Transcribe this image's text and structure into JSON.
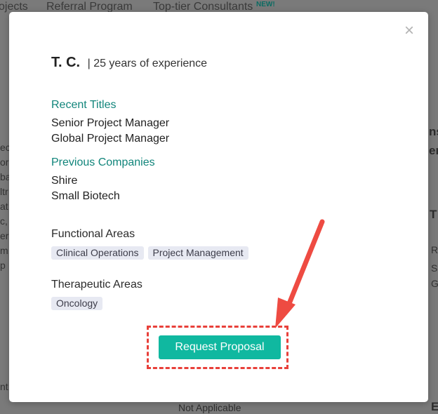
{
  "background": {
    "nav": [
      "ojects",
      "Referral Program",
      "Top-tier Consultants"
    ],
    "nav_badge": "NEW!",
    "left_fragments": "ect\nor\nba\nltr\nat\nc,\ner\nm.\np",
    "left_bottom": "nt",
    "right_fragments": [
      "ns",
      "er"
    ],
    "right_t": "T",
    "right_small": [
      "R",
      "S",
      "G"
    ],
    "bottom_text": "Not Applicable",
    "bottom_right": "E"
  },
  "modal": {
    "name": "T. C.",
    "separator": "|",
    "experience": "25 years of experience",
    "recent_titles_label": "Recent Titles",
    "recent_titles": [
      "Senior Project Manager",
      "Global Project Manager"
    ],
    "previous_companies_label": "Previous Companies",
    "previous_companies": [
      "Shire",
      "Small Biotech"
    ],
    "functional_areas_label": "Functional Areas",
    "functional_areas": [
      "Clinical Operations",
      "Project Management"
    ],
    "therapeutic_areas_label": "Therapeutic Areas",
    "therapeutic_areas": [
      "Oncology"
    ],
    "cta_label": "Request Proposal",
    "close_icon": "×"
  },
  "colors": {
    "teal_text": "#11857b",
    "cta_bg": "#10b8a0",
    "annotation": "#e8403a",
    "tag_bg": "#e7e9f2"
  }
}
